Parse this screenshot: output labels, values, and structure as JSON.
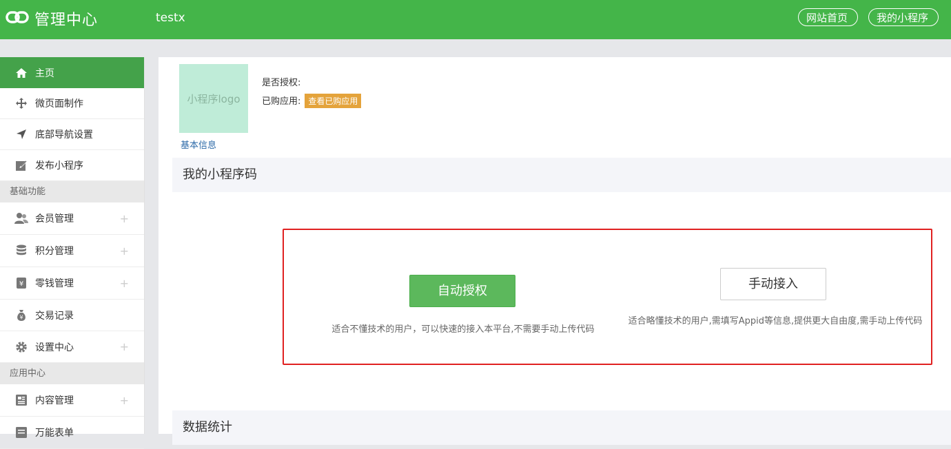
{
  "header": {
    "title": "管理中心",
    "app_name": "testx",
    "buttons": [
      "网站首页",
      "我的小程序"
    ]
  },
  "sidebar": {
    "items_top": [
      {
        "label": "主页",
        "icon": "home-icon",
        "active": true
      },
      {
        "label": "微页面制作",
        "icon": "move-icon"
      },
      {
        "label": "底部导航设置",
        "icon": "navigation-arrow-icon"
      },
      {
        "label": "发布小程序",
        "icon": "edit-square-icon"
      }
    ],
    "section1": "基础功能",
    "items_basic": [
      {
        "label": "会员管理",
        "icon": "users-icon",
        "plus": "+"
      },
      {
        "label": "积分管理",
        "icon": "database-icon",
        "plus": "+"
      },
      {
        "label": "零钱管理",
        "icon": "wallet-yen-icon",
        "plus": "+"
      },
      {
        "label": "交易记录",
        "icon": "money-bag-icon"
      },
      {
        "label": "设置中心",
        "icon": "gear-icon",
        "plus": "+"
      }
    ],
    "section2": "应用中心",
    "items_app": [
      {
        "label": "内容管理",
        "icon": "newspaper-icon",
        "plus": "+"
      },
      {
        "label": "万能表单",
        "icon": "form-icon"
      }
    ]
  },
  "main": {
    "logo_placeholder": "小程序logo",
    "basic_info_link": "基本信息",
    "auth_label": "是否授权:",
    "purchased_label": "已购应用:",
    "purchased_button": "查看已购应用",
    "qrcode_section": "我的小程序码",
    "auto_auth_button": "自动授权",
    "auto_auth_desc": "适合不懂技术的用户，可以快速的接入本平台,不需要手动上传代码",
    "manual_button": "手动接入",
    "manual_desc": "适合略懂技术的用户,需填写Appid等信息,提供更大自由度,需手动上传代码",
    "stats_section": "数据统计"
  },
  "colors": {
    "brand_green": "#44b549",
    "active_green": "#44a24a",
    "button_green": "#5cb85c",
    "tag_orange": "#e4a33b",
    "highlight_red": "#e02020",
    "link_blue": "#2d6aa8"
  }
}
